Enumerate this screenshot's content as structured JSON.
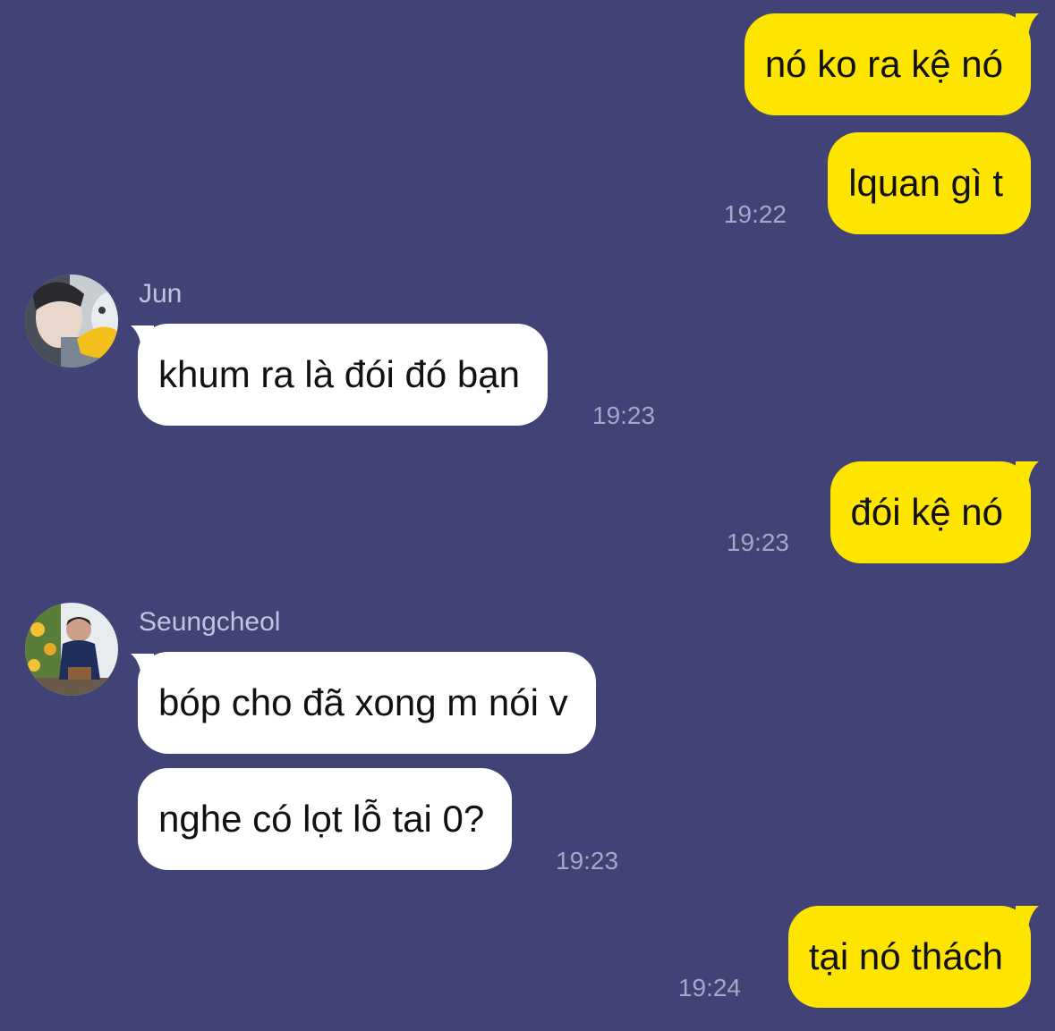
{
  "colors": {
    "background": "#414275",
    "outgoing_bubble": "#fde500",
    "incoming_bubble": "#ffffff",
    "timestamp": "#a6a7c6",
    "sender_name": "#c2c3dc"
  },
  "messages": [
    {
      "direction": "outgoing",
      "text": "nó ko ra kệ nó"
    },
    {
      "direction": "outgoing",
      "text": "lquan gì t",
      "time": "19:22"
    },
    {
      "direction": "incoming",
      "sender": "Jun",
      "avatar": "jun-avatar",
      "text": "khum ra là đói đó bạn",
      "time": "19:23"
    },
    {
      "direction": "outgoing",
      "text": "đói kệ nó",
      "time": "19:23"
    },
    {
      "direction": "incoming",
      "sender": "Seungcheol",
      "avatar": "seungcheol-avatar",
      "text": "bóp cho đã xong m nói v"
    },
    {
      "direction": "incoming",
      "text": "nghe có lọt lỗ tai 0?",
      "time": "19:23"
    },
    {
      "direction": "outgoing",
      "text": "tại nó thách",
      "time": "19:24"
    }
  ]
}
